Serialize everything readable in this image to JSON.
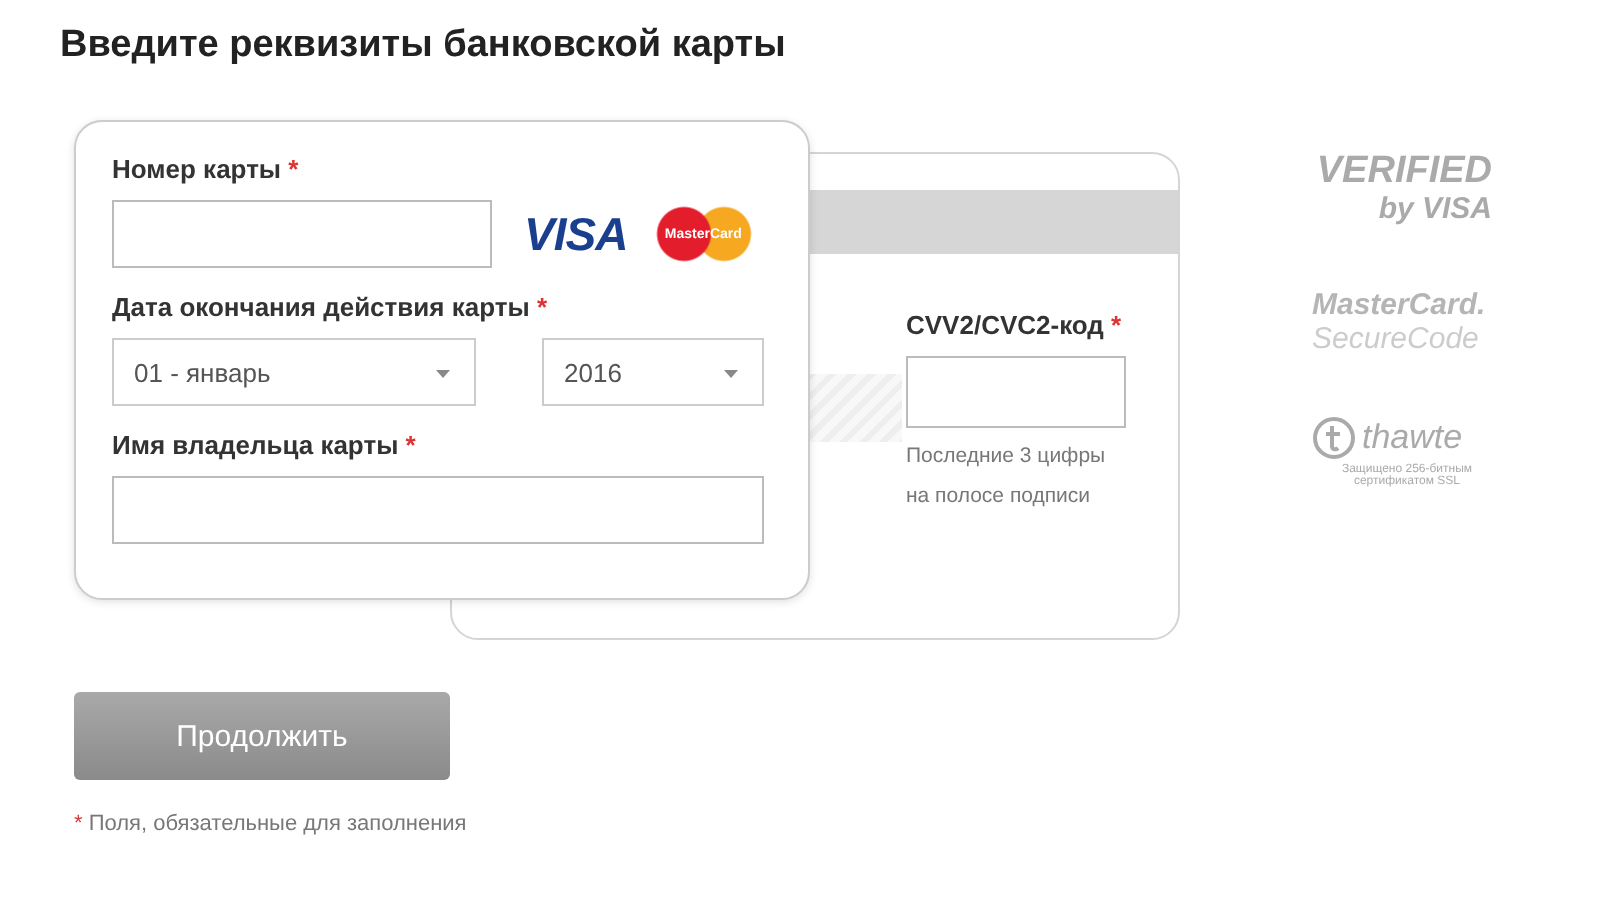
{
  "title": "Введите реквизиты банковской карты",
  "card_front": {
    "fields": [
      {
        "kind": "text",
        "label": "Номер карты",
        "mark": "*",
        "brands": [
          "VISA",
          "MasterCard"
        ]
      },
      {
        "kind": "selects",
        "label": "Дата окончания действия карты",
        "mark": "*",
        "selects": [
          {
            "value": "01 - январь"
          },
          {
            "value": "2016"
          }
        ]
      },
      {
        "kind": "text",
        "label": "Имя владельца карты",
        "mark": "*"
      }
    ]
  },
  "card_back": {
    "label": "CVV2/CVC2-код",
    "mark": "*",
    "hint": "Последние 3 цифры на полосе подписи"
  },
  "badges": [
    {
      "kind": "verified",
      "lines": [
        "VERIFIED",
        "by VISA"
      ]
    },
    {
      "kind": "securecode",
      "lines": [
        "MasterCard.",
        "SecureCode"
      ]
    },
    {
      "kind": "thawte",
      "lines": [
        "thawte",
        "Защищено 256-битным",
        "сертификатом SSL"
      ]
    }
  ],
  "submit": {
    "label": "Продолжить",
    "disabled": true
  },
  "footnote": {
    "mark": "*",
    "text": "Поля, обязательные для заполнения"
  }
}
